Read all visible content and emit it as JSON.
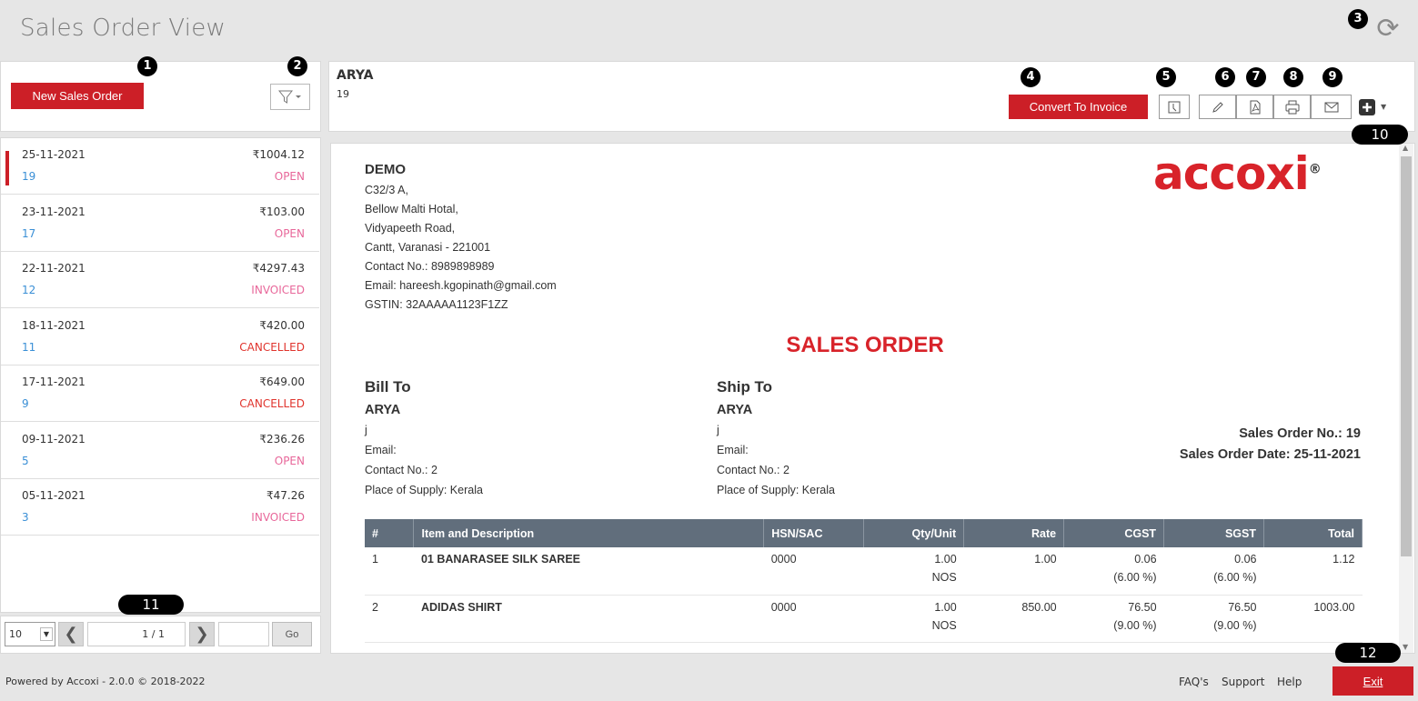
{
  "app": {
    "title": "Sales Order View",
    "refresh_icon": "refresh-icon"
  },
  "sidebar": {
    "new_button": "New Sales Order",
    "filter_icon": "filter-icon",
    "orders": [
      {
        "date": "25-11-2021",
        "amount": "₹1004.12",
        "number": "19",
        "status": "OPEN",
        "selected": true
      },
      {
        "date": "23-11-2021",
        "amount": "₹103.00",
        "number": "17",
        "status": "OPEN"
      },
      {
        "date": "22-11-2021",
        "amount": "₹4297.43",
        "number": "12",
        "status": "INVOICED"
      },
      {
        "date": "18-11-2021",
        "amount": "₹420.00",
        "number": "11",
        "status": "CANCELLED"
      },
      {
        "date": "17-11-2021",
        "amount": "₹649.00",
        "number": "9",
        "status": "CANCELLED"
      },
      {
        "date": "09-11-2021",
        "amount": "₹236.26",
        "number": "5",
        "status": "OPEN"
      },
      {
        "date": "05-11-2021",
        "amount": "₹47.26",
        "number": "3",
        "status": "INVOICED"
      }
    ],
    "pager": {
      "page_size": "10",
      "page_info": "1 / 1",
      "go_label": "Go",
      "goto_value": ""
    }
  },
  "header": {
    "customer": "ARYA",
    "order_no": "19",
    "convert_button": "Convert To Invoice"
  },
  "toolbar_icons": [
    "history-icon",
    "edit-icon",
    "pdf-icon",
    "print-icon",
    "email-icon",
    "add-icon"
  ],
  "badges": [
    "1",
    "2",
    "3",
    "4",
    "5",
    "6",
    "7",
    "8",
    "9",
    "10",
    "11",
    "12"
  ],
  "document": {
    "company": "DEMO",
    "address": [
      "C32/3 A,",
      "Bellow Malti Hotal,",
      "Vidyapeeth Road,",
      "Cantt, Varanasi - 221001",
      "Contact No.: 8989898989",
      "Email: hareesh.kgopinath@gmail.com",
      "GSTIN: 32AAAAA1123F1ZZ"
    ],
    "logo": "accoxi",
    "heading": "SALES ORDER",
    "bill_to": {
      "label": "Bill To",
      "name": "ARYA",
      "lines": [
        "j",
        "Email:",
        "Contact No.: 2",
        "Place of Supply: Kerala"
      ]
    },
    "ship_to": {
      "label": "Ship To",
      "name": "ARYA",
      "lines": [
        "j",
        "Email:",
        "Contact No.: 2",
        "Place of Supply: Kerala"
      ]
    },
    "order_no_label": "Sales Order No.: 19",
    "order_date_label": "Sales Order Date: 25-11-2021",
    "columns": [
      "#",
      "Item and Description",
      "HSN/SAC",
      "Qty/Unit",
      "Rate",
      "CGST",
      "SGST",
      "Total"
    ],
    "rows": [
      {
        "idx": "1",
        "item": "01 BANARASEE SILK SAREE",
        "hsn": "0000",
        "qty": "1.00",
        "unit": "NOS",
        "rate": "1.00",
        "cgst": "0.06",
        "cgst_pct": "(6.00 %)",
        "sgst": "0.06",
        "sgst_pct": "(6.00 %)",
        "total": "1.12"
      },
      {
        "idx": "2",
        "item": "ADIDAS SHIRT",
        "hsn": "0000",
        "qty": "1.00",
        "unit": "NOS",
        "rate": "850.00",
        "cgst": "76.50",
        "cgst_pct": "(9.00 %)",
        "sgst": "76.50",
        "sgst_pct": "(9.00 %)",
        "total": "1003.00"
      }
    ]
  },
  "footer": {
    "powered": "Powered by Accoxi - 2.0.0 © 2018-2022",
    "faq": "FAQ's",
    "support": "Support",
    "help": "Help",
    "exit": "Exit"
  },
  "colors": {
    "accent": "#cc1f27",
    "table_header": "#616e7c",
    "link_blue": "#3a8fd6",
    "status_pink": "#e8679a",
    "status_red": "#e0342d"
  }
}
